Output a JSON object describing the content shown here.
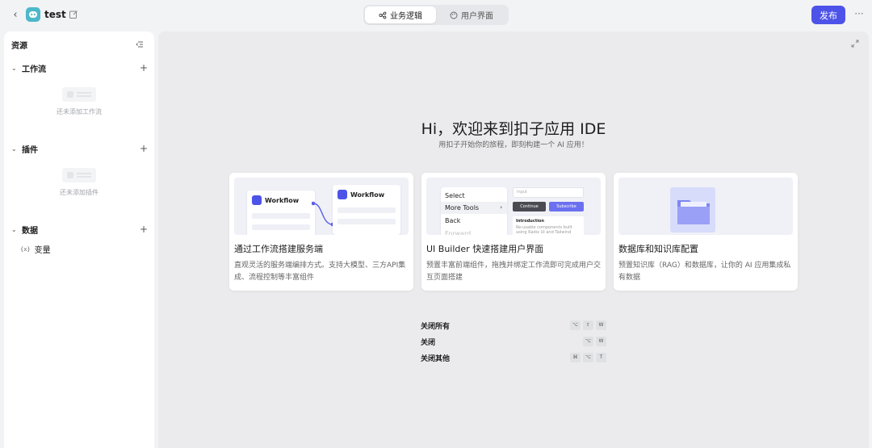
{
  "topbar": {
    "app_name": "test",
    "tabs": [
      {
        "label": "业务逻辑",
        "active": true
      },
      {
        "label": "用户界面",
        "active": false
      }
    ],
    "publish_label": "发布"
  },
  "sidebar": {
    "header": "资源",
    "sections": [
      {
        "title": "工作流",
        "empty_text": "还未添加工作流"
      },
      {
        "title": "插件",
        "empty_text": "还未添加插件"
      },
      {
        "title": "数据"
      }
    ],
    "data_items": [
      {
        "icon_text": "{x}",
        "label": "变量"
      }
    ]
  },
  "main": {
    "title": "Hi，欢迎来到扣子应用 IDE",
    "subtitle": "用扣子开始你的旅程，即刻构建一个 AI 应用！",
    "cards": [
      {
        "title": "通过工作流搭建服务端",
        "description": "直观灵活的服务端编排方式。支持大模型、三方API集成、流程控制等丰富组件",
        "illus": {
          "box1": "Workflow",
          "box2": "Workflow"
        }
      },
      {
        "title": "UI Builder 快速搭建用户界面",
        "description": "预置丰富前端组件，拖拽并绑定工作流即可完成用户交互页面搭建",
        "illus": {
          "menu": [
            "Select",
            "More Tools",
            "Back",
            "Forward"
          ],
          "input_placeholder": "Input",
          "btn_continue": "Continue",
          "btn_subscribe": "Subscribe",
          "intro_title": "Introduction",
          "intro_text": "Re-usable components built using Radix UI and Tailwind"
        }
      },
      {
        "title": "数据库和知识库配置",
        "description": "预置知识库（RAG）和数据库，让你的 AI 应用集成私有数据"
      }
    ],
    "shortcuts": [
      {
        "label": "关闭所有",
        "keys": [
          "⌥",
          "⇧",
          "W"
        ]
      },
      {
        "label": "关闭",
        "keys": [
          "⌥",
          "W"
        ]
      },
      {
        "label": "关闭其他",
        "keys": [
          "⌘",
          "⌥",
          "T"
        ]
      }
    ]
  },
  "colors": {
    "accent": "#4d53e8",
    "avatar": "#4db8c9"
  }
}
